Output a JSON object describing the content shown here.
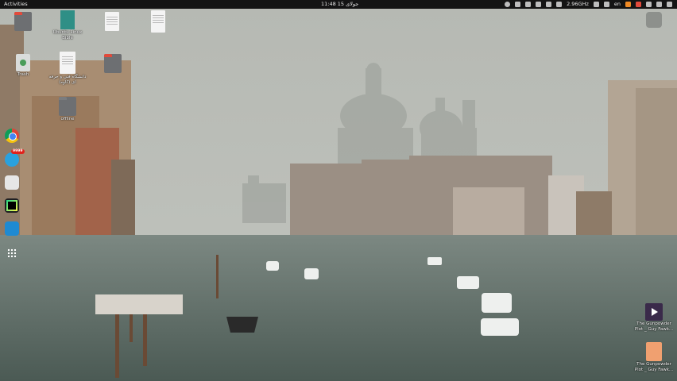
{
  "topbar": {
    "activities": "Activities",
    "clock": "11:48  15 جولای",
    "cpu": "2.96GHz",
    "language": "en"
  },
  "desktop_icons": [
    {
      "id": "home",
      "label": "",
      "type": "folder"
    },
    {
      "id": "book",
      "label": "Ubuntu Linux Bible",
      "type": "book"
    },
    {
      "id": "doc1",
      "label": "",
      "type": "document"
    },
    {
      "id": "doc2",
      "label": "",
      "type": "document"
    },
    {
      "id": "trash",
      "label": "Trash",
      "type": "trash"
    },
    {
      "id": "uni-doc",
      "label": "دانشگاه فنی و حرفه ای (کاوه)",
      "type": "document"
    },
    {
      "id": "folder-red",
      "label": "",
      "type": "folder"
    },
    {
      "id": "offline",
      "label": "offline",
      "type": "folder"
    },
    {
      "id": "gunpowder-video",
      "label": "The Gunpowder Plot _ Guy Fawk...",
      "type": "video"
    },
    {
      "id": "gunpowder-audio",
      "label": "The Gunpowder Plot _ Guy Fawk...",
      "type": "audio"
    }
  ],
  "dock": {
    "telegram_badge": "9999"
  },
  "colors": {
    "sky": "#b8bcb5",
    "water": "#5e6d66",
    "topbar": "#141414"
  }
}
